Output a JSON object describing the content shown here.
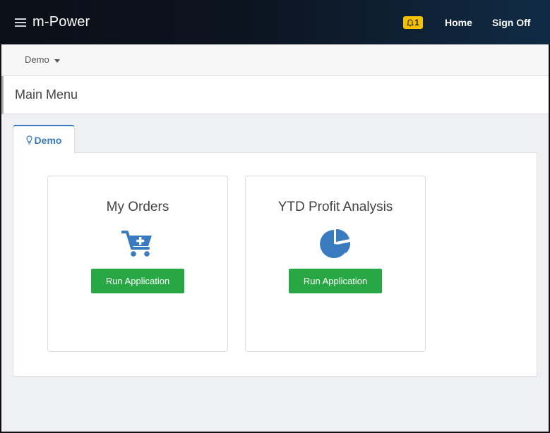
{
  "navbar": {
    "brand": "m-Power",
    "notification_count": "1",
    "links": {
      "home": "Home",
      "sign_off": "Sign Off"
    },
    "colors": {
      "notification_badge": "#f5c200"
    }
  },
  "subbar": {
    "menu_label": "Demo"
  },
  "page": {
    "title": "Main Menu"
  },
  "tabs": [
    {
      "label": "Demo",
      "icon": "lightbulb-icon",
      "active": true
    }
  ],
  "cards": [
    {
      "title": "My Orders",
      "icon": "cart-plus-icon",
      "button_label": "Run Application"
    },
    {
      "title": "YTD Profit Analysis",
      "icon": "pie-chart-icon",
      "button_label": "Run Application"
    }
  ],
  "colors": {
    "accent": "#3a7bbf",
    "run_button": "#28a745"
  }
}
